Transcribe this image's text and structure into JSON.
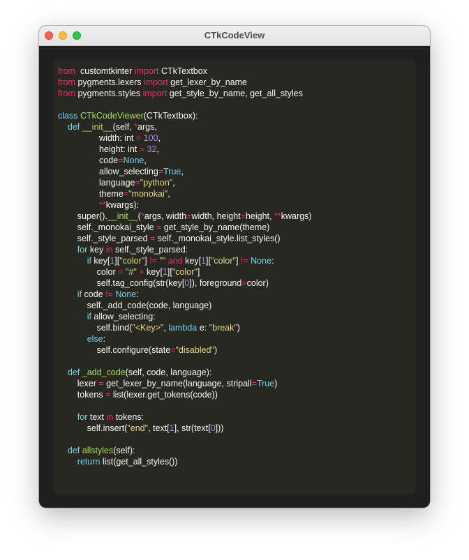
{
  "window": {
    "title": "CTkCodeView"
  },
  "code": {
    "lines": [
      [
        [
          "kwi",
          "from"
        ],
        [
          "",
          "  customtkinter "
        ],
        [
          "kwi",
          "import"
        ],
        [
          "",
          " CTkTextbox"
        ]
      ],
      [
        [
          "kwi",
          "from"
        ],
        [
          "",
          " pygments.lexers "
        ],
        [
          "kwi",
          "import"
        ],
        [
          "",
          " get_lexer_by_name"
        ]
      ],
      [
        [
          "kwi",
          "from"
        ],
        [
          "",
          " pygments.styles "
        ],
        [
          "kwi",
          "import"
        ],
        [
          "",
          " get_style_by_name, get_all_styles"
        ]
      ],
      [],
      [
        [
          "kw",
          "class"
        ],
        [
          "",
          " "
        ],
        [
          "fn",
          "CTkCodeViewer"
        ],
        [
          "",
          "(CTkTextbox):"
        ]
      ],
      [
        [
          "",
          "    "
        ],
        [
          "kw",
          "def"
        ],
        [
          "",
          " "
        ],
        [
          "fn",
          "__init__"
        ],
        [
          "",
          "(self, "
        ],
        [
          "op",
          "*"
        ],
        [
          "",
          "args,"
        ]
      ],
      [
        [
          "",
          "                 width: int "
        ],
        [
          "op",
          "="
        ],
        [
          "",
          " "
        ],
        [
          "num",
          "100"
        ],
        [
          "",
          ","
        ]
      ],
      [
        [
          "",
          "                 height: int "
        ],
        [
          "op",
          "="
        ],
        [
          "",
          " "
        ],
        [
          "num",
          "32"
        ],
        [
          "",
          ","
        ]
      ],
      [
        [
          "",
          "                 code"
        ],
        [
          "op",
          "="
        ],
        [
          "kw",
          "None"
        ],
        [
          "",
          ","
        ]
      ],
      [
        [
          "",
          "                 allow_selecting"
        ],
        [
          "op",
          "="
        ],
        [
          "kw",
          "True"
        ],
        [
          "",
          ","
        ]
      ],
      [
        [
          "",
          "                 language"
        ],
        [
          "op",
          "="
        ],
        [
          "str",
          "\"python\""
        ],
        [
          "",
          ","
        ]
      ],
      [
        [
          "",
          "                 theme"
        ],
        [
          "op",
          "="
        ],
        [
          "str",
          "\"monokai\""
        ],
        [
          "",
          ","
        ]
      ],
      [
        [
          "",
          "                 "
        ],
        [
          "op",
          "**"
        ],
        [
          "",
          "kwargs):"
        ]
      ],
      [
        [
          "",
          "        super()."
        ],
        [
          "fn",
          "__init__"
        ],
        [
          "",
          "("
        ],
        [
          "op",
          "*"
        ],
        [
          "",
          "args, width"
        ],
        [
          "op",
          "="
        ],
        [
          "",
          "width, height"
        ],
        [
          "op",
          "="
        ],
        [
          "",
          "height, "
        ],
        [
          "op",
          "**"
        ],
        [
          "",
          "kwargs)"
        ]
      ],
      [
        [
          "",
          "        self._monokai_style "
        ],
        [
          "op",
          "="
        ],
        [
          "",
          " get_style_by_name(theme)"
        ]
      ],
      [
        [
          "",
          "        self._style_parsed "
        ],
        [
          "op",
          "="
        ],
        [
          "",
          " self._monokai_style.list_styles()"
        ]
      ],
      [
        [
          "",
          "        "
        ],
        [
          "kw",
          "for"
        ],
        [
          "",
          " key "
        ],
        [
          "kwi",
          "in"
        ],
        [
          "",
          " self._style_parsed:"
        ]
      ],
      [
        [
          "",
          "            "
        ],
        [
          "kw",
          "if"
        ],
        [
          "",
          " key["
        ],
        [
          "num",
          "1"
        ],
        [
          "",
          "]["
        ],
        [
          "str",
          "\"color\""
        ],
        [
          "",
          "] "
        ],
        [
          "op",
          "!="
        ],
        [
          "",
          " "
        ],
        [
          "str",
          "\"\""
        ],
        [
          "",
          " "
        ],
        [
          "kwi",
          "and"
        ],
        [
          "",
          " key["
        ],
        [
          "num",
          "1"
        ],
        [
          "",
          "]["
        ],
        [
          "str",
          "\"color\""
        ],
        [
          "",
          "] "
        ],
        [
          "op",
          "!="
        ],
        [
          "",
          " "
        ],
        [
          "kw",
          "None"
        ],
        [
          "",
          ":"
        ]
      ],
      [
        [
          "",
          "                color "
        ],
        [
          "op",
          "="
        ],
        [
          "",
          " "
        ],
        [
          "str",
          "\"#\""
        ],
        [
          "",
          " "
        ],
        [
          "op",
          "+"
        ],
        [
          "",
          " key["
        ],
        [
          "num",
          "1"
        ],
        [
          "",
          "]["
        ],
        [
          "str",
          "\"color\""
        ],
        [
          "",
          "]"
        ]
      ],
      [
        [
          "",
          "                self.tag_config(str(key["
        ],
        [
          "num",
          "0"
        ],
        [
          "",
          "]), foreground"
        ],
        [
          "op",
          "="
        ],
        [
          "",
          "color)"
        ]
      ],
      [
        [
          "",
          "        "
        ],
        [
          "kw",
          "if"
        ],
        [
          "",
          " code "
        ],
        [
          "op",
          "!="
        ],
        [
          "",
          " "
        ],
        [
          "kw",
          "None"
        ],
        [
          "",
          ":"
        ]
      ],
      [
        [
          "",
          "            self._add_code(code, language)"
        ]
      ],
      [
        [
          "",
          "            "
        ],
        [
          "kw",
          "if"
        ],
        [
          "",
          " allow_selecting:"
        ]
      ],
      [
        [
          "",
          "                self.bind("
        ],
        [
          "str",
          "\"<Key>\""
        ],
        [
          "",
          ", "
        ],
        [
          "kw",
          "lambda"
        ],
        [
          "",
          " e: "
        ],
        [
          "str",
          "\"break\""
        ],
        [
          "",
          ")"
        ]
      ],
      [
        [
          "",
          "            "
        ],
        [
          "kw",
          "else"
        ],
        [
          "",
          ":"
        ]
      ],
      [
        [
          "",
          "                self.configure(state"
        ],
        [
          "op",
          "="
        ],
        [
          "str",
          "\"disabled\""
        ],
        [
          "",
          ")"
        ]
      ],
      [],
      [
        [
          "",
          "    "
        ],
        [
          "kw",
          "def"
        ],
        [
          "",
          " "
        ],
        [
          "fn",
          "_add_code"
        ],
        [
          "",
          "(self, code, language):"
        ]
      ],
      [
        [
          "",
          "        lexer "
        ],
        [
          "op",
          "="
        ],
        [
          "",
          " get_lexer_by_name(language, stripall"
        ],
        [
          "op",
          "="
        ],
        [
          "kw",
          "True"
        ],
        [
          "",
          ")"
        ]
      ],
      [
        [
          "",
          "        tokens "
        ],
        [
          "op",
          "="
        ],
        [
          "",
          " list(lexer.get_tokens(code))"
        ]
      ],
      [],
      [
        [
          "",
          "        "
        ],
        [
          "kw",
          "for"
        ],
        [
          "",
          " text "
        ],
        [
          "kwi",
          "in"
        ],
        [
          "",
          " tokens:"
        ]
      ],
      [
        [
          "",
          "            self.insert("
        ],
        [
          "str",
          "\"end\""
        ],
        [
          "",
          ", text["
        ],
        [
          "num",
          "1"
        ],
        [
          "",
          "], str(text["
        ],
        [
          "num",
          "0"
        ],
        [
          "",
          "]))"
        ]
      ],
      [],
      [
        [
          "",
          "    "
        ],
        [
          "kw",
          "def"
        ],
        [
          "",
          " "
        ],
        [
          "fn",
          "allstyles"
        ],
        [
          "",
          "(self):"
        ]
      ],
      [
        [
          "",
          "        "
        ],
        [
          "kw",
          "return"
        ],
        [
          "",
          " list(get_all_styles())"
        ]
      ]
    ]
  }
}
